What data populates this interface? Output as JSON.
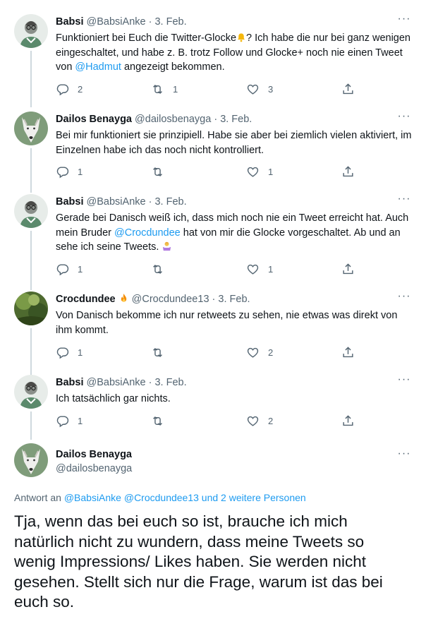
{
  "tweets": [
    {
      "name": "Babsi",
      "handle": "@BabsiAnke",
      "separator": "·",
      "date": "3. Feb.",
      "text_parts": [
        "Funktioniert bei Euch die Twitter-Glocke",
        "? Ich habe die nur bei ganz wenigen eingeschaltet, und habe z. B. trotz Follow und Glocke+ noch nie einen Tweet von ",
        "@Hadmut",
        " angezeigt bekommen."
      ],
      "replies": "2",
      "retweets": "1",
      "likes": "3",
      "avatar": "man-with-glasses-avatar"
    },
    {
      "name": "Dailos Benayga",
      "handle": "@dailosbenayga",
      "separator": "·",
      "date": "3. Feb.",
      "text": "Bei mir funktioniert sie prinzipiell. Habe sie aber bei ziemlich vielen aktiviert, im Einzelnen habe ich das noch nicht kontrolliert.",
      "replies": "1",
      "retweets": "",
      "likes": "1",
      "avatar": "white-wolf-avatar"
    },
    {
      "name": "Babsi",
      "handle": "@BabsiAnke",
      "separator": "·",
      "date": "3. Feb.",
      "text_parts": [
        "Gerade bei Danisch weiß ich, dass mich noch nie ein Tweet erreicht hat. Auch mein Bruder ",
        "@Crocdundee",
        " hat von mir die Glocke vorgeschaltet. Ab und an sehe ich seine Tweets. "
      ],
      "replies": "1",
      "retweets": "",
      "likes": "1",
      "avatar": "man-with-glasses-avatar"
    },
    {
      "name": "Crocdundee",
      "handle": "@Crocdundee13",
      "separator": "·",
      "date": "3. Feb.",
      "text": "Von Danisch bekomme ich nur retweets zu sehen, nie etwas was direkt von ihm kommt.",
      "replies": "1",
      "retweets": "",
      "likes": "2",
      "avatar": "green-nature-avatar"
    },
    {
      "name": "Babsi",
      "handle": "@BabsiAnke",
      "separator": "·",
      "date": "3. Feb.",
      "text": "Ich tatsächlich gar nichts.",
      "replies": "1",
      "retweets": "",
      "likes": "2",
      "avatar": "man-with-glasses-avatar"
    }
  ],
  "focal": {
    "name": "Dailos Benayga",
    "handle": "@dailosbenayga",
    "reply_prefix": "Antwort an ",
    "reply_to": "@BabsiAnke @Crocdundee13 und 2 weitere Personen",
    "text": "Tja, wenn das bei euch so ist, brauche ich mich natürlich nicht zu wundern, dass meine Tweets so wenig Impressions/ Likes haben. Sie werden nicht gesehen. Stellt sich nur die Frage, warum ist das bei euch so.",
    "avatar": "white-wolf-avatar"
  },
  "more_label": "···",
  "colors": {
    "link": "#1d9bf0",
    "secondary": "#536471",
    "text": "#0f1419",
    "line": "#cfd9de"
  }
}
